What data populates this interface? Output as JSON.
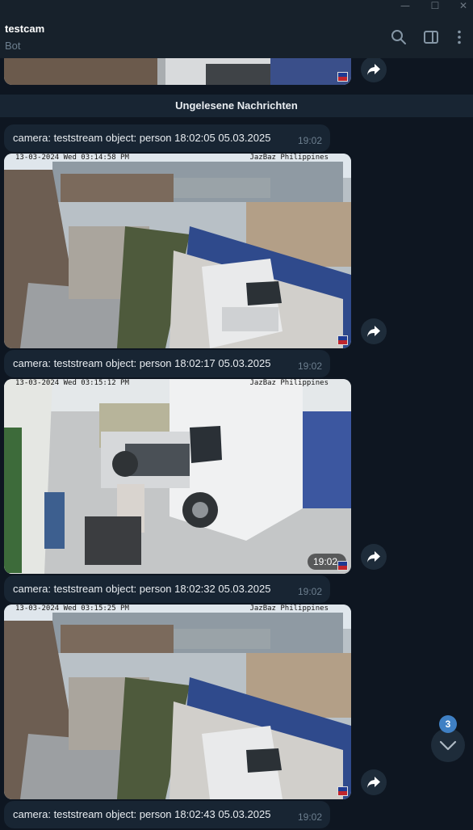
{
  "window": {
    "minimize_glyph": "—",
    "maximize_glyph": "☐",
    "close_glyph": "✕"
  },
  "header": {
    "title": "testcam",
    "subtitle": "Bot",
    "icons": [
      "search-icon",
      "sidebar-toggle-icon",
      "more-vertical-icon"
    ]
  },
  "colors": {
    "background": "#0e1621",
    "header": "#17212b",
    "bubble": "#182533",
    "badge": "#3f80c4",
    "time": "#6d7f8f"
  },
  "chat": {
    "unread_divider": "Ungelesene Nachrichten",
    "messages": [
      {
        "caption": "camera: teststream object: person   18:02:05 05.03.2025",
        "time": "19:02"
      },
      {
        "caption": "camera: teststream object: person   18:02:17 05.03.2025",
        "time": "19:02"
      },
      {
        "caption": "camera: teststream object: person   18:02:32 05.03.2025",
        "time": "19:02"
      },
      {
        "caption": "camera: teststream object: person   18:02:43 05.03.2025",
        "time": "19:02"
      }
    ],
    "photos": [
      {
        "timestamp": "13-03-2024 Wed 03:14:58 PM",
        "brand": "JazBaz Philippines"
      },
      {
        "timestamp": "13-03-2024 Wed 03:15:12 PM",
        "brand": "JazBaz Philippines",
        "time": "19:02"
      },
      {
        "timestamp": "13-03-2024 Wed 03:15:25 PM",
        "brand": "JazBaz Philippines"
      }
    ],
    "unread_count": "3"
  }
}
